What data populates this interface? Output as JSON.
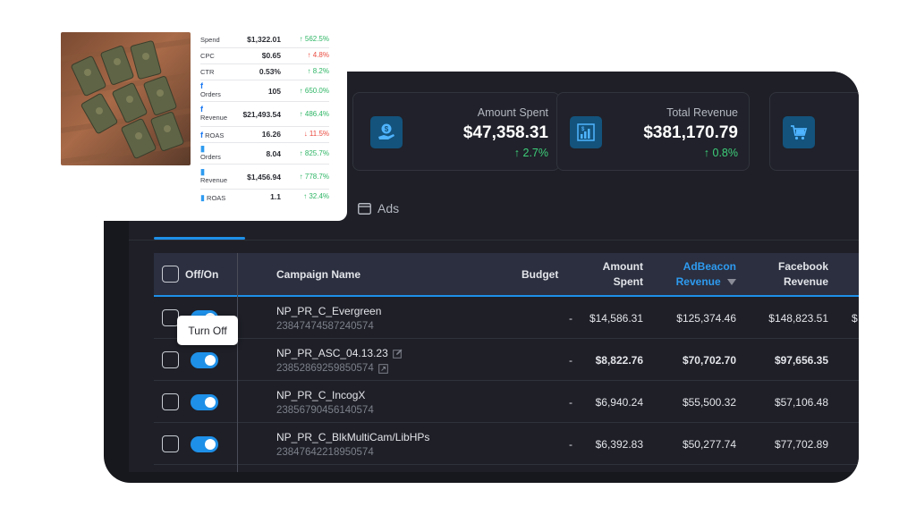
{
  "kpis": [
    {
      "label": "Amount Spent",
      "value": "$47,358.31",
      "change": "↑ 2.7%",
      "icon": "money-hand-icon"
    },
    {
      "label": "Total Revenue",
      "value": "$381,170.79",
      "change": "↑ 0.8%",
      "icon": "revenue-bar-chart-icon"
    },
    {
      "icon": "cart-icon"
    }
  ],
  "tabs": {
    "ads": "Ads"
  },
  "table": {
    "headers": {
      "toggle": "Off/On",
      "name": "Campaign Name",
      "budget": "Budget",
      "amount_spent": [
        "Amount",
        "Spent"
      ],
      "adbeacon_revenue": [
        "AdBeacon",
        "Revenue"
      ],
      "facebook_revenue": [
        "Facebook",
        "Revenue"
      ]
    },
    "rows": [
      {
        "name": "NP_PR_C_Evergreen",
        "id": "23847474587240574",
        "budget": "-",
        "spent": "$14,586.31",
        "adbeacon": "$125,374.46",
        "facebook": "$148,823.51",
        "extra": "$"
      },
      {
        "name": "NP_PR_ASC_04.13.23",
        "id": "23852869259850574",
        "budget": "-",
        "spent": "$8,822.76",
        "adbeacon": "$70,702.70",
        "facebook": "$97,656.35"
      },
      {
        "name": "NP_PR_C_IncogX",
        "id": "23856790456140574",
        "budget": "-",
        "spent": "$6,940.24",
        "adbeacon": "$55,500.32",
        "facebook": "$57,106.48"
      },
      {
        "name": "NP_PR_C_BlkMultiCam/LibHPs",
        "id": "23847642218950574",
        "budget": "-",
        "spent": "$6,392.83",
        "adbeacon": "$50,277.74",
        "facebook": "$77,702.89"
      }
    ]
  },
  "tooltip": "Turn Off",
  "card": {
    "metrics": [
      {
        "label": "Spend",
        "value": "$1,322.01",
        "change": "↑ 562.5%",
        "dir": "up"
      },
      {
        "label": "CPC",
        "value": "$0.65",
        "change": "↑ 4.8%",
        "dir": "down"
      },
      {
        "label": "CTR",
        "value": "0.53%",
        "change": "↑ 8.2%",
        "dir": "up"
      },
      {
        "label": "Orders",
        "value": "105",
        "change": "↑ 650.0%",
        "dir": "up",
        "icon": "facebook-icon"
      },
      {
        "label": "Revenue",
        "value": "$21,493.54",
        "change": "↑ 486.4%",
        "dir": "up",
        "icon": "facebook-icon"
      },
      {
        "label": "ROAS",
        "value": "16.26",
        "change": "↓ 11.5%",
        "dir": "down",
        "icon": "facebook-icon"
      },
      {
        "label": "Orders",
        "value": "8.04",
        "change": "↑ 825.7%",
        "dir": "up",
        "icon": "adbeacon-icon"
      },
      {
        "label": "Revenue",
        "value": "$1,456.94",
        "change": "↑ 778.7%",
        "dir": "up",
        "icon": "adbeacon-icon"
      },
      {
        "label": "ROAS",
        "value": "1.1",
        "change": "↑ 32.4%",
        "dir": "up",
        "icon": "adbeacon-icon"
      }
    ]
  },
  "colors": {
    "accent": "#1e90e8",
    "positive": "#3ecf7a",
    "negative": "#ea4a3f",
    "panel": "#1e1f27"
  }
}
